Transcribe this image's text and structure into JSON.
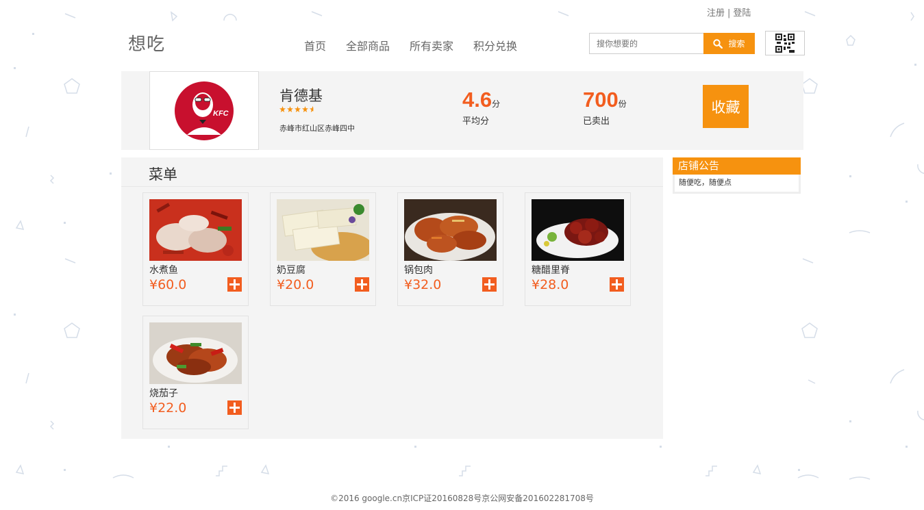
{
  "header": {
    "auth": {
      "register": "注册",
      "separator": "|",
      "login": "登陆"
    },
    "logo": "想吃",
    "nav": [
      {
        "label": "首页"
      },
      {
        "label": "全部商品"
      },
      {
        "label": "所有卖家"
      },
      {
        "label": "积分兑换"
      }
    ],
    "search": {
      "placeholder": "搜你想要的",
      "button_label": "搜索"
    },
    "qr_icon": "qr-code-icon"
  },
  "shop": {
    "logo_text": "KFC",
    "name": "肯德基",
    "rating": 4.6,
    "address": "赤峰市红山区赤峰四中",
    "avg_score": {
      "value": "4.6",
      "unit": "分",
      "label": "平均分"
    },
    "sold": {
      "value": "700",
      "unit": "份",
      "label": "已卖出"
    },
    "favorite_label": "收藏"
  },
  "menu": {
    "title": "菜单",
    "items": [
      {
        "name": "水煮鱼",
        "price": "¥60.0"
      },
      {
        "name": "奶豆腐",
        "price": "¥20.0"
      },
      {
        "name": "锅包肉",
        "price": "¥32.0"
      },
      {
        "name": "糖醋里脊",
        "price": "¥28.0"
      },
      {
        "name": "烧茄子",
        "price": "¥22.0"
      }
    ]
  },
  "notice": {
    "title": "店铺公告",
    "text": "随便吃，随便点"
  },
  "footer": {
    "text": "©2016 google.cn京ICP证20160828号京公网安备201602281708号"
  },
  "colors": {
    "accent": "#f6920f",
    "price": "#f25d1f",
    "panel": "#f4f4f4"
  }
}
